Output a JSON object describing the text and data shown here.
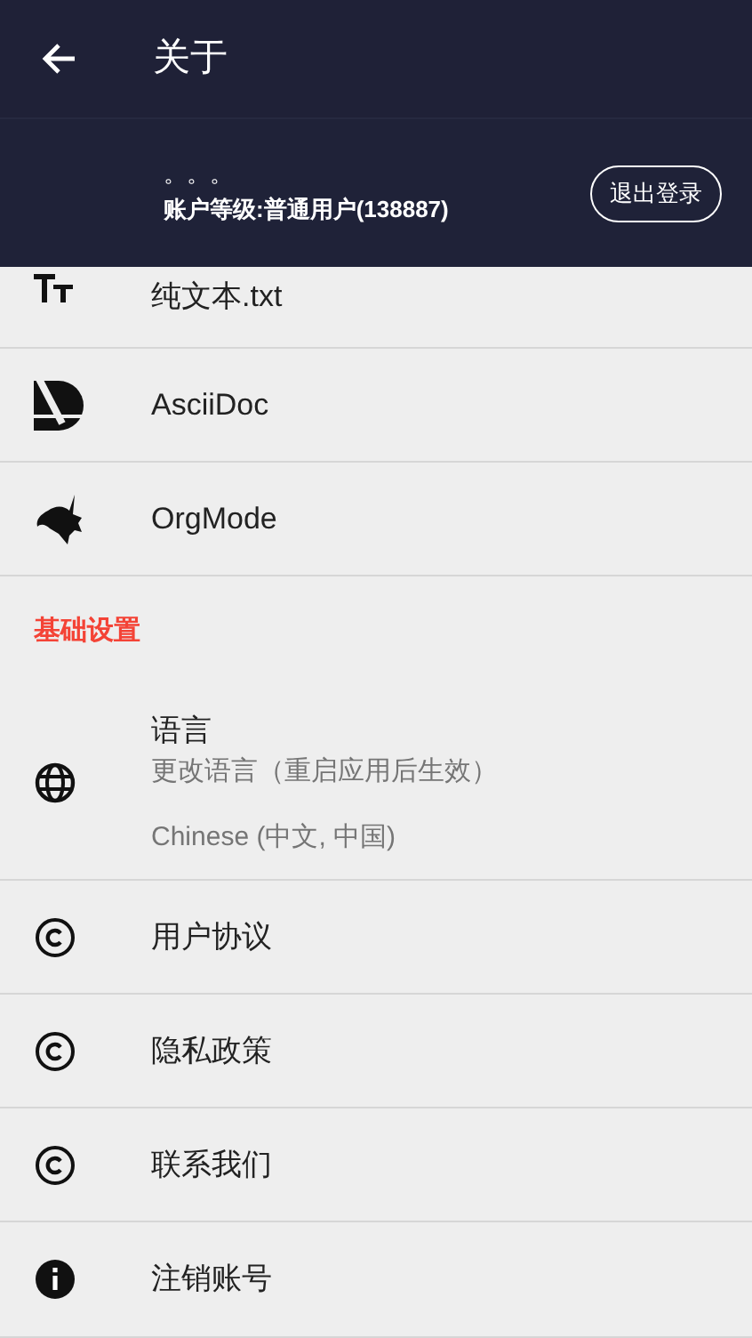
{
  "app_bar": {
    "title": "关于"
  },
  "account": {
    "dots": "。。。",
    "level": "账户等级:普通用户(138887)",
    "logout": "退出登录"
  },
  "items": [
    {
      "kind": "text",
      "label": "纯文本.txt"
    },
    {
      "kind": "asciidoc",
      "label": "AsciiDoc"
    },
    {
      "kind": "org",
      "label": "OrgMode"
    }
  ],
  "section": {
    "title": "基础设置"
  },
  "language": {
    "title": "语言",
    "subtitle": "更改语言（重启应用后生效）",
    "value": "Chinese (中文, 中国)"
  },
  "settings": [
    {
      "kind": "copyright",
      "label": "用户协议"
    },
    {
      "kind": "copyright",
      "label": "隐私政策"
    },
    {
      "kind": "copyright",
      "label": "联系我们"
    },
    {
      "kind": "info",
      "label": "注销账号"
    }
  ]
}
